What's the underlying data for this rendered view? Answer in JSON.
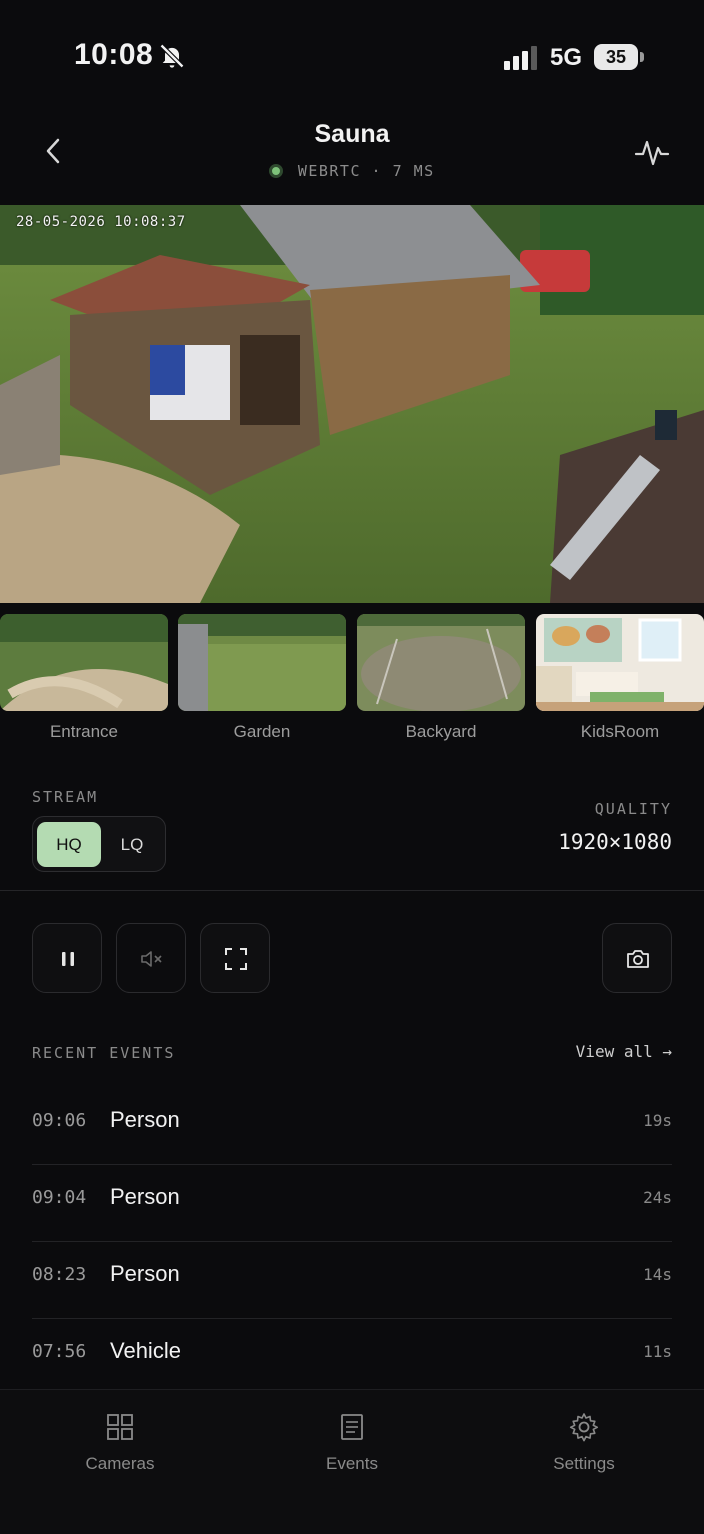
{
  "status_bar": {
    "time": "10:08",
    "network": "5G",
    "battery": "35"
  },
  "header": {
    "title": "Sauna",
    "protocol": "WEBRTC",
    "latency": "7 MS",
    "separator": "·"
  },
  "video": {
    "timestamp": "28-05-2026 10:08:37"
  },
  "cameras": [
    {
      "name": "Entrance"
    },
    {
      "name": "Garden"
    },
    {
      "name": "Backyard"
    },
    {
      "name": "KidsRoom"
    }
  ],
  "stream": {
    "label": "STREAM",
    "options": [
      "HQ",
      "LQ"
    ],
    "selected": "HQ"
  },
  "quality": {
    "label": "QUALITY",
    "value": "1920×1080"
  },
  "controls": {
    "icons": [
      "pause-icon",
      "mute-icon",
      "fullscreen-icon",
      "camera-snapshot-icon"
    ]
  },
  "events": {
    "title": "RECENT EVENTS",
    "view_all": "View all →",
    "items": [
      {
        "time": "09:06",
        "type": "Person",
        "duration": "19s"
      },
      {
        "time": "09:04",
        "type": "Person",
        "duration": "24s"
      },
      {
        "time": "08:23",
        "type": "Person",
        "duration": "14s"
      },
      {
        "time": "07:56",
        "type": "Vehicle",
        "duration": "11s"
      }
    ]
  },
  "tabs": [
    {
      "label": "Cameras",
      "icon": "grid-icon"
    },
    {
      "label": "Events",
      "icon": "document-icon"
    },
    {
      "label": "Settings",
      "icon": "gear-icon"
    }
  ],
  "colors": {
    "accent": "#b4dbb2",
    "live_dot": "#7ec27a",
    "background": "#0b0b0d"
  }
}
